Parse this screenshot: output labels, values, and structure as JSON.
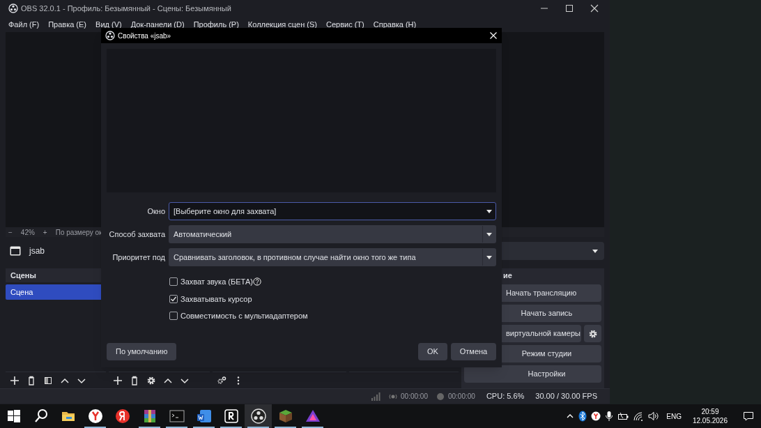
{
  "window": {
    "title": "OBS 32.0.1 - Профиль: Безымянный - Сцены: Безымянный"
  },
  "menu": [
    "Файл (F)",
    "Правка (E)",
    "Вид (V)",
    "Док-панели (D)",
    "Профиль (P)",
    "Коллекция сцен (S)",
    "Сервис (T)",
    "Справка (H)"
  ],
  "zoom_bar": {
    "minus": "−",
    "zoom": "42%",
    "plus": "+",
    "fit": "По размеру ок"
  },
  "source_bar": {
    "name": "jsab"
  },
  "scenes_dock": {
    "title": "Сцены",
    "items": [
      {
        "label": "Сцена",
        "selected": true
      }
    ]
  },
  "controls_dock": {
    "title": "ие",
    "buttons": [
      {
        "label": "Начать трансляцию",
        "settings": false
      },
      {
        "label": "Начать запись",
        "settings": false
      },
      {
        "label": "виртуальной камеры",
        "settings": true
      },
      {
        "label": "Режим студии",
        "settings": false
      },
      {
        "label": "Настройки",
        "settings": false
      }
    ]
  },
  "status_bar": {
    "stream_time": "00:00:00",
    "record_time": "00:00:00",
    "cpu": "CPU: 5.6%",
    "fps": "30.00 / 30.00 FPS"
  },
  "dialog": {
    "title": "Свойства «jsab»",
    "fields": [
      {
        "label": "Окно",
        "value": "[Выберите окно для захвата]",
        "focused": true
      },
      {
        "label": "Способ захвата",
        "value": "Автоматический",
        "focused": false
      },
      {
        "label": "Приоритет под",
        "value": "Сравнивать заголовок, в противном случае найти окно того же типа",
        "focused": false
      }
    ],
    "checkboxes": [
      {
        "label": "Захват звука (БЕТА)",
        "checked": false,
        "help": true
      },
      {
        "label": "Захватывать курсор",
        "checked": true,
        "help": false
      },
      {
        "label": "Совместимость с мультиадаптером",
        "checked": false,
        "help": false
      }
    ],
    "defaults_button": "По умолчанию",
    "ok_button": "OK",
    "cancel_button": "Отмена"
  },
  "taskbar": {
    "apps": [
      {
        "kind": "start",
        "running": false,
        "selected": false
      },
      {
        "kind": "search",
        "running": false,
        "selected": false
      },
      {
        "kind": "folder",
        "running": false,
        "selected": false
      },
      {
        "kind": "browser",
        "running": true,
        "selected": false
      },
      {
        "kind": "letter",
        "running": false,
        "selected": false
      },
      {
        "kind": "archive",
        "running": true,
        "selected": false
      },
      {
        "kind": "terminal",
        "running": true,
        "selected": false
      },
      {
        "kind": "word",
        "running": true,
        "selected": false
      },
      {
        "kind": "rapp",
        "running": true,
        "selected": false
      },
      {
        "kind": "obs",
        "running": true,
        "selected": true
      },
      {
        "kind": "block",
        "running": true,
        "selected": false
      },
      {
        "kind": "triangle",
        "running": true,
        "selected": false
      }
    ],
    "language": "ENG",
    "time": "20:59",
    "date": "12.05.2026"
  }
}
